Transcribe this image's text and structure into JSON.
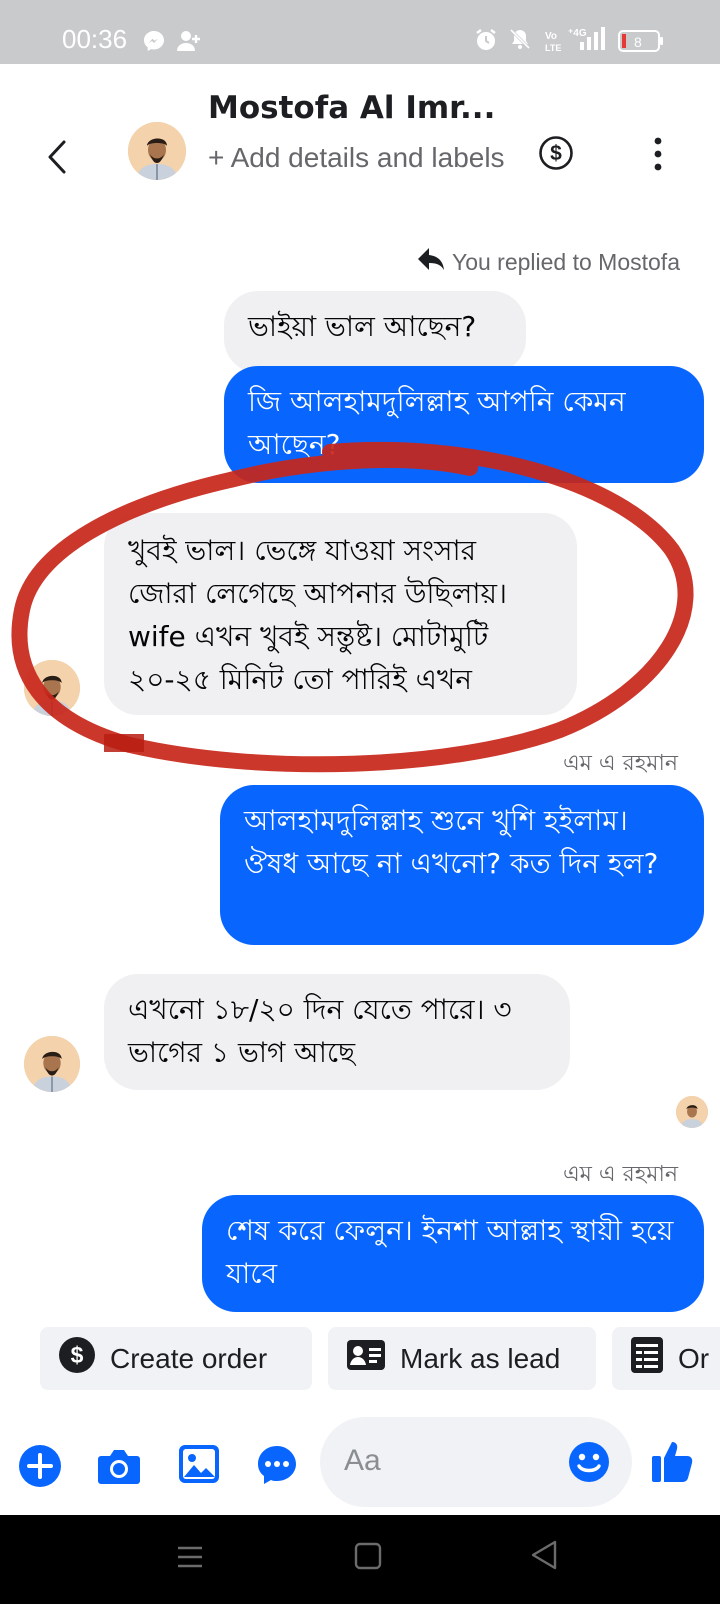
{
  "status_bar": {
    "time": "00:36",
    "icons": [
      "messenger-icon",
      "person-add-icon",
      "alarm-icon",
      "mute-icon",
      "volte-icon",
      "4g-signal-icon",
      "battery-icon"
    ],
    "battery_level": "8"
  },
  "header": {
    "contact_name": "Mostofa Al Imr...",
    "sub_label": "+ Add details and labels"
  },
  "reply_note": "You replied to Mostofa",
  "messages": [
    {
      "from": "in",
      "text": "ভাইয়া ভাল আছেন?"
    },
    {
      "from": "out",
      "text": "জি আলহামদুলিল্লাহ আপনি কেমন আছেন?"
    },
    {
      "from": "in",
      "text": "খুবই ভাল। ভেঙ্গে যাওয়া সংসার জোরা লেগেছে আপনার উছিলায়। wife এখন খুবই সন্তুষ্ট। মোটামুটি ২০-২৫ মিনিট তো পারিই এখন"
    },
    {
      "from": "out",
      "text": "আলহামদুলিল্লাহ শুনে খুশি হইলাম। ঔষধ আছে না এখনো? কত দিন হল?"
    },
    {
      "from": "in",
      "text": "এখনো ১৮/২০ দিন যেতে পারে। ৩ ভাগের ১ ভাগ আছে"
    },
    {
      "from": "out",
      "text": "শেষ করে ফেলুন। ইনশা আল্লাহ স্থায়ী হয়ে যাবে"
    }
  ],
  "sender_labels": [
    "এম এ রহমান",
    "এম এ রহমান"
  ],
  "quick_actions": [
    {
      "label": "Create order",
      "icon": "dollar-circle-icon"
    },
    {
      "label": "Mark as lead",
      "icon": "contact-card-icon"
    },
    {
      "label": "Or",
      "icon": "document-list-icon"
    }
  ],
  "composer": {
    "placeholder": "Aa",
    "icons": [
      "plus-icon",
      "camera-icon",
      "gallery-icon",
      "chat-icon",
      "emoji-icon",
      "like-icon"
    ]
  },
  "colors": {
    "accent": "#0866ff",
    "incoming_bubble": "#f0f0f2",
    "highlight_ring": "#c8261a",
    "status_bar": "#c9cacc"
  }
}
